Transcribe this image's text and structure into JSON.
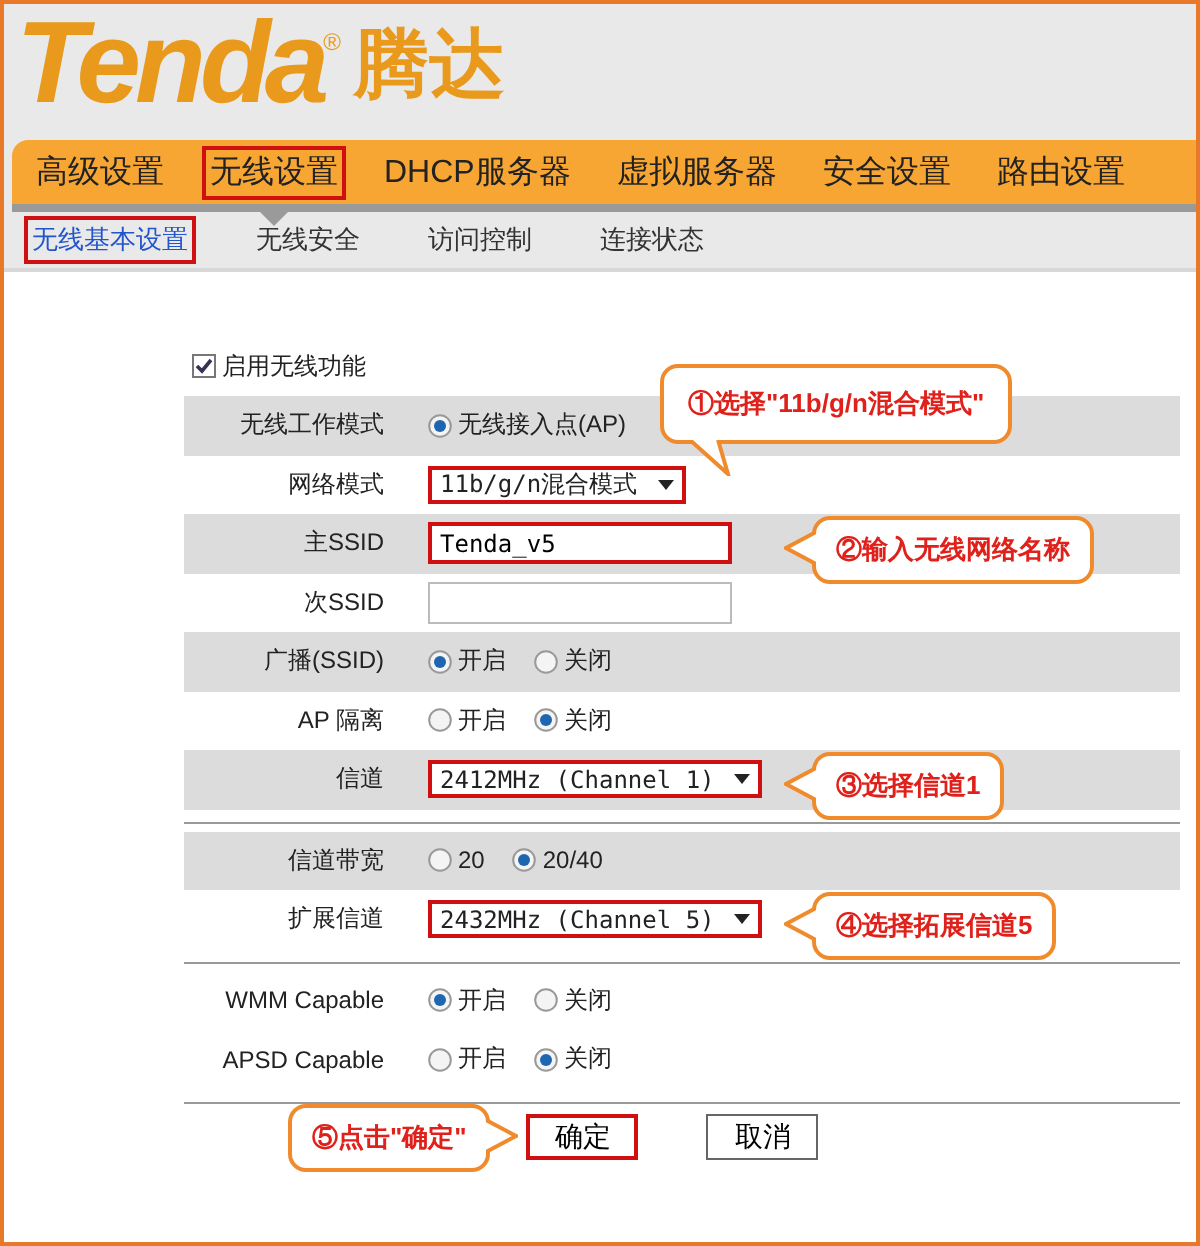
{
  "logo": {
    "brand": "Tenda",
    "mark": "®",
    "name": "腾达"
  },
  "nav": [
    {
      "label": "高级设置",
      "selected": false,
      "highlighted": false
    },
    {
      "label": "无线设置",
      "selected": true,
      "highlighted": true
    },
    {
      "label": "DHCP服务器",
      "selected": false,
      "highlighted": false
    },
    {
      "label": "虚拟服务器",
      "selected": false,
      "highlighted": false
    },
    {
      "label": "安全设置",
      "selected": false,
      "highlighted": false
    },
    {
      "label": "路由设置",
      "selected": false,
      "highlighted": false
    }
  ],
  "subnav": [
    {
      "label": "无线基本设置",
      "selected": true,
      "highlighted": true
    },
    {
      "label": "无线安全",
      "selected": false,
      "highlighted": false
    },
    {
      "label": "访问控制",
      "selected": false,
      "highlighted": false
    },
    {
      "label": "连接状态",
      "selected": false,
      "highlighted": false
    }
  ],
  "enable": {
    "label": "启用无线功能",
    "checked": true
  },
  "sections": [
    {
      "kind": "striped",
      "rows": [
        {
          "kind": "radio",
          "label": "无线工作模式",
          "options": [
            {
              "label": "无线接入点(AP)",
              "selected": true
            }
          ]
        },
        {
          "kind": "select",
          "label": "网络模式",
          "value": "11b/g/n混合模式",
          "highlighted": true,
          "callout": {
            "text": "①选择\"11b/g/n混合模式\"",
            "kind": "down"
          }
        },
        {
          "kind": "text",
          "label": "主SSID",
          "value": "Tenda_v5",
          "highlighted": true,
          "callout": {
            "text": "②输入无线网络名称",
            "kind": "left"
          }
        },
        {
          "kind": "text",
          "label": "次SSID",
          "value": "",
          "highlighted": false
        },
        {
          "kind": "radio",
          "label": "广播(SSID)",
          "options": [
            {
              "label": "开启",
              "selected": true
            },
            {
              "label": "关闭",
              "selected": false
            }
          ]
        },
        {
          "kind": "radio",
          "label": "AP 隔离",
          "options": [
            {
              "label": "开启",
              "selected": false
            },
            {
              "label": "关闭",
              "selected": true
            }
          ]
        },
        {
          "kind": "select",
          "label": "信道",
          "value": "2412MHz (Channel 1)",
          "highlighted": true,
          "callout": {
            "text": "③选择信道1",
            "kind": "left"
          }
        }
      ]
    },
    {
      "kind": "striped",
      "rows": [
        {
          "kind": "radio",
          "label": "信道带宽",
          "options": [
            {
              "label": "20",
              "selected": false
            },
            {
              "label": "20/40",
              "selected": true
            }
          ]
        },
        {
          "kind": "select",
          "label": "扩展信道",
          "value": "2432MHz (Channel 5)",
          "highlighted": true,
          "callout": {
            "text": "④选择拓展信道5",
            "kind": "left"
          }
        }
      ]
    },
    {
      "kind": "plain",
      "rows": [
        {
          "kind": "radio",
          "label": "WMM Capable",
          "options": [
            {
              "label": "开启",
              "selected": true
            },
            {
              "label": "关闭",
              "selected": false
            }
          ]
        },
        {
          "kind": "radio",
          "label": "APSD Capable",
          "options": [
            {
              "label": "开启",
              "selected": false
            },
            {
              "label": "关闭",
              "selected": true
            }
          ]
        }
      ]
    }
  ],
  "buttons": {
    "callout": {
      "text": "⑤点击\"确定\"",
      "kind": "right"
    },
    "items": [
      {
        "label": "确定",
        "highlighted": true
      },
      {
        "label": "取消",
        "highlighted": false
      }
    ]
  }
}
